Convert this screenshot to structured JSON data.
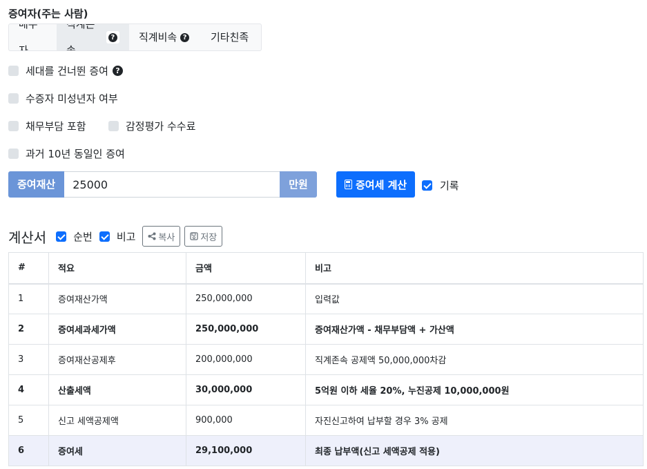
{
  "donor": {
    "title": "증여자(주는 사람)",
    "tabs": [
      {
        "label": "배우자",
        "has_help": false
      },
      {
        "label": "직계존속",
        "has_help": true
      },
      {
        "label": "직계비속",
        "has_help": true
      },
      {
        "label": "기타친족",
        "has_help": false
      }
    ],
    "active_tab": "직계존속",
    "help_glyph": "?"
  },
  "options": {
    "generation_skip": {
      "label": "세대를 건너뛴 증여",
      "checked": false
    },
    "minor_recipient": {
      "label": "수증자 미성년자 여부",
      "checked": false
    },
    "debt_included": {
      "label": "채무부담 포함",
      "checked": false
    },
    "appraisal_fee": {
      "label": "감정평가 수수료",
      "checked": false
    },
    "past_10y_same": {
      "label": "과거 10년 동일인 증여",
      "checked": false
    }
  },
  "asset_input": {
    "prefix": "증여재산",
    "value": "25000",
    "suffix": "만원"
  },
  "calc_button": {
    "label": "증여세 계산",
    "icon": "calculator-icon"
  },
  "record": {
    "label": "기록",
    "checked": true
  },
  "sheet": {
    "title": "계산서",
    "order_label": "순번",
    "order_checked": true,
    "note_label": "비고",
    "note_checked": true,
    "copy_label": "복사",
    "copy_icon": "share-icon",
    "save_label": "저장",
    "save_icon": "save-icon",
    "headers": [
      "#",
      "적요",
      "금액",
      "비고"
    ],
    "rows": [
      {
        "no": "1",
        "desc": "증여재산가액",
        "amount": "250,000,000",
        "note": "입력값"
      },
      {
        "no": "2",
        "desc": "증여세과세가액",
        "amount": "250,000,000",
        "note": "증여재산가액 - 채무부담액 + 가산액"
      },
      {
        "no": "3",
        "desc": "증여재산공제후",
        "amount": "200,000,000",
        "note": "직계존속 공제액 50,000,000차감"
      },
      {
        "no": "4",
        "desc": "산출세액",
        "amount": "30,000,000",
        "note": "5억원 이하 세율 20%, 누진공제 10,000,000원"
      },
      {
        "no": "5",
        "desc": "신고 세액공제액",
        "amount": "900,000",
        "note": "자진신고하여 납부할 경우 3% 공제"
      },
      {
        "no": "6",
        "desc": "증여세",
        "amount": "29,100,000",
        "note": "최종 납부액(신고 세액공제 적용)"
      }
    ]
  },
  "colors": {
    "primary": "#0d6efd",
    "input_addon": "#6b95d8",
    "highlight_row": "#eef0fb"
  }
}
